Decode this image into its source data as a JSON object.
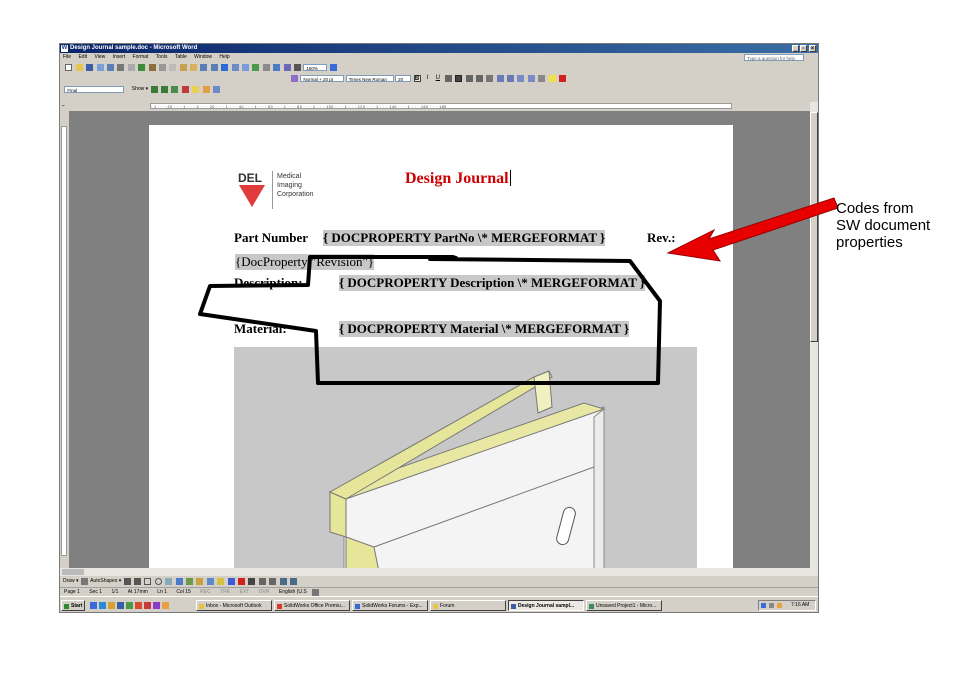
{
  "window": {
    "title": "Design Journal sample.doc - Microsoft Word",
    "controls": {
      "minimize": "_",
      "restore": "▫",
      "close": "×"
    }
  },
  "menubar": {
    "items": [
      "File",
      "Edit",
      "View",
      "Insert",
      "Format",
      "Tools",
      "Table",
      "Window",
      "Help"
    ],
    "help_placeholder": "Type a question for help"
  },
  "toolbar": {
    "zoom": "150%",
    "style": "Normal + 20 pt",
    "font": "Times New Roman",
    "size": "20",
    "bold": "B",
    "italic": "I",
    "underline": "U"
  },
  "reviewing": {
    "view": "Final",
    "show": "Show ▾"
  },
  "ruler_text": "· 1 · · · 20 · · · 1 · · · 2 · · · 20 · · · 1 · · · 40 · · · 1 · · · 60 · · · 1 · · · 80 · · · 1 · · · 100 · · · 1 · · · 120 · · · 1 · · · 140 · · · 1 · · · 160 · · · 180",
  "document": {
    "logo_name": "DEL",
    "logo_lines": [
      "Medical",
      "Imaging",
      "Corporation"
    ],
    "heading": "Design Journal",
    "part_number_label": "Part Number",
    "part_number_field": "{ DOCPROPERTY  PartNo  \\* MERGEFORMAT }",
    "rev_label": "Rev.:",
    "revision_field": "{DocProperty \"Revision\"}",
    "description_label": "Description:",
    "description_field": "{ DOCPROPERTY  Description  \\* MERGEFORMAT }",
    "material_label": "Material:",
    "material_field": "{ DOCPROPERTY  Material  \\* MERGEFORMAT }"
  },
  "drawbar": {
    "draw": "Draw ▾",
    "autoshapes": "AutoShapes ▾"
  },
  "statusbar": {
    "page": "Page 1",
    "section": "Sec 1",
    "pages": "1/1",
    "at": "At 17mm",
    "line": "Ln 1",
    "col": "Col 15",
    "rec": "REC",
    "trk": "TRK",
    "ext": "EXT",
    "ovr": "OVR",
    "lang": "English (U.S"
  },
  "taskbar": {
    "start": "Start",
    "tasks": [
      "Inbox - Microsoft Outlook",
      "SolidWorks Office Premiu...",
      "SolidWorks Forums - Exp...",
      "Forum",
      "Design Journal sampl...",
      "Unsaved Project1 - Micro..."
    ],
    "clock": "7:16 AM"
  },
  "annotation": {
    "lines": [
      "Codes from",
      "SW document",
      "properties"
    ]
  },
  "colors": {
    "title_red": "#cc0000",
    "annotation_arrow": "#e80000",
    "part_fill": "#e6e69a",
    "title_bar": "#0a246a"
  }
}
